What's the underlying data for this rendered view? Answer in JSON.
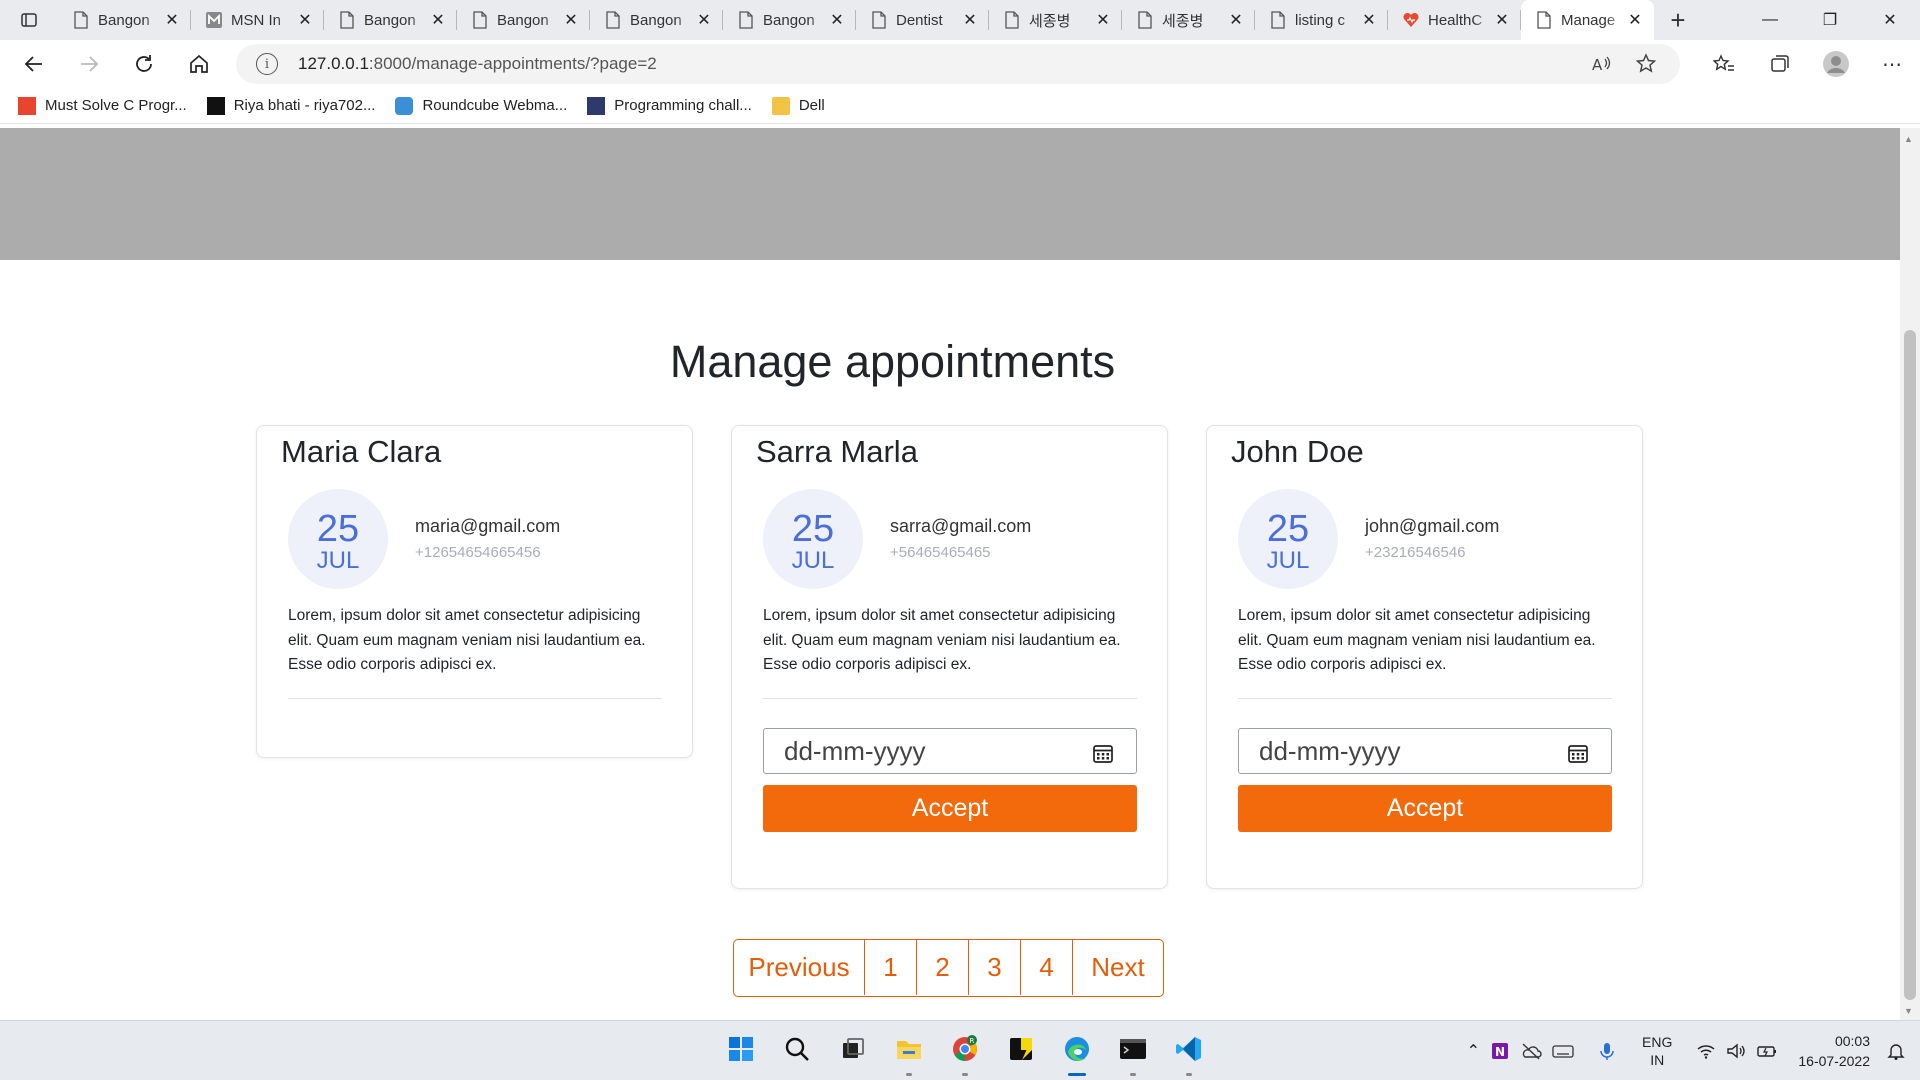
{
  "browser": {
    "tabs": [
      {
        "title": "Bangon",
        "icon": "page-icon"
      },
      {
        "title": "MSN In",
        "icon": "msn-icon"
      },
      {
        "title": "Bangon",
        "icon": "page-icon"
      },
      {
        "title": "Bangon",
        "icon": "page-icon"
      },
      {
        "title": "Bangon",
        "icon": "page-icon"
      },
      {
        "title": "Bangon",
        "icon": "page-icon"
      },
      {
        "title": "Dentist",
        "icon": "page-icon"
      },
      {
        "title": "세종병",
        "icon": "page-icon"
      },
      {
        "title": "세종병",
        "icon": "page-icon"
      },
      {
        "title": "listing c",
        "icon": "page-icon"
      },
      {
        "title": "HealthC",
        "icon": "health-icon"
      },
      {
        "title": "Manage",
        "icon": "page-icon"
      }
    ],
    "url_host": "127.0.0.1",
    "url_path": ":8000/manage-appointments/?page=2",
    "bookmarks": [
      {
        "label": "Must Solve C Progr...",
        "color": "#e8442e"
      },
      {
        "label": "Riya bhati - riya702...",
        "color": "#111111"
      },
      {
        "label": "Roundcube Webma...",
        "color": "#3b8fd4"
      },
      {
        "label": "Programming chall...",
        "color": "#2d3a6b"
      },
      {
        "label": "Dell",
        "color": "#f2c443"
      }
    ]
  },
  "page": {
    "title": "Manage appointments",
    "appointments": [
      {
        "name": "Maria Clara",
        "day": "25",
        "month": "JUL",
        "email": "maria@gmail.com",
        "phone": "+12654654665456",
        "description": "Lorem, ipsum dolor sit amet consectetur adipisicing elit. Quam eum magnam veniam nisi laudantium ea. Esse odio corporis adipisci ex.",
        "has_actions": false
      },
      {
        "name": "Sarra Marla",
        "day": "25",
        "month": "JUL",
        "email": "sarra@gmail.com",
        "phone": "+56465465465",
        "description": "Lorem, ipsum dolor sit amet consectetur adipisicing elit. Quam eum magnam veniam nisi laudantium ea. Esse odio corporis adipisci ex.",
        "has_actions": true,
        "date_placeholder": "dd-mm-yyyy",
        "accept_label": "Accept"
      },
      {
        "name": "John Doe",
        "day": "25",
        "month": "JUL",
        "email": "john@gmail.com",
        "phone": "+23216546546",
        "description": "Lorem, ipsum dolor sit amet consectetur adipisicing elit. Quam eum magnam veniam nisi laudantium ea. Esse odio corporis adipisci ex.",
        "has_actions": true,
        "date_placeholder": "dd-mm-yyyy",
        "accept_label": "Accept"
      }
    ],
    "pagination": {
      "previous": "Previous",
      "pages": [
        "1",
        "2",
        "3",
        "4"
      ],
      "next": "Next"
    }
  },
  "colors": {
    "accent": "#f26a0c",
    "date_text": "#4a6fd6",
    "hero_gray": "#acacac"
  },
  "taskbar": {
    "apps": [
      "windows-start-icon",
      "search-icon",
      "task-view-icon",
      "file-explorer-icon",
      "chrome-icon",
      "sticky-notes-icon",
      "edge-icon",
      "terminal-icon",
      "vscode-icon"
    ],
    "language_line1": "ENG",
    "language_line2": "IN",
    "time": "00:03",
    "date": "16-07-2022"
  }
}
